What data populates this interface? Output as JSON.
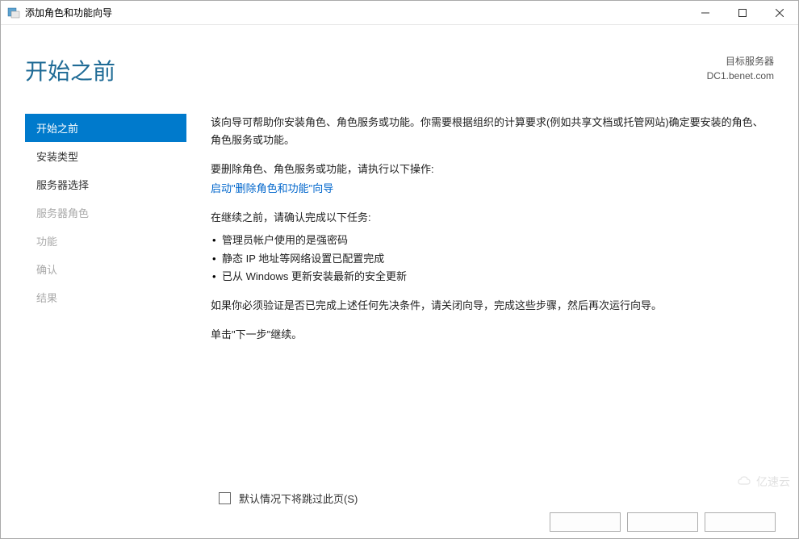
{
  "window": {
    "title": "添加角色和功能向导"
  },
  "header": {
    "pageTitle": "开始之前",
    "serverLabel": "目标服务器",
    "serverName": "DC1.benet.com"
  },
  "nav": {
    "items": [
      {
        "label": "开始之前",
        "state": "selected"
      },
      {
        "label": "安装类型",
        "state": "enabled"
      },
      {
        "label": "服务器选择",
        "state": "enabled"
      },
      {
        "label": "服务器角色",
        "state": "disabled"
      },
      {
        "label": "功能",
        "state": "disabled"
      },
      {
        "label": "确认",
        "state": "disabled"
      },
      {
        "label": "结果",
        "state": "disabled"
      }
    ]
  },
  "content": {
    "intro": "该向导可帮助你安装角色、角色服务或功能。你需要根据组织的计算要求(例如共享文档或托管网站)确定要安装的角色、角色服务或功能。",
    "removeInstruction": "要删除角色、角色服务或功能，请执行以下操作:",
    "removeLink": "启动\"删除角色和功能\"向导",
    "prereqIntro": "在继续之前，请确认完成以下任务:",
    "tasks": [
      "管理员帐户使用的是强密码",
      "静态 IP 地址等网络设置已配置完成",
      "已从 Windows 更新安装最新的安全更新"
    ],
    "verifyNote": "如果你必须验证是否已完成上述任何先决条件，请关闭向导，完成这些步骤，然后再次运行向导。",
    "continueNote": "单击\"下一步\"继续。",
    "skipCheckbox": "默认情况下将跳过此页(S)"
  },
  "watermark": {
    "text": "亿速云"
  }
}
